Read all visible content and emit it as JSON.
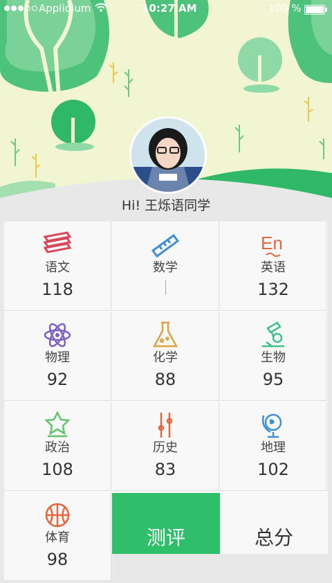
{
  "status_bar": {
    "carrier": "Applidium",
    "time": "10:27 AM",
    "battery": "100 %"
  },
  "profile": {
    "greeting": "Hi! 王烁语同学"
  },
  "subjects": [
    {
      "label": "语文",
      "score": "118",
      "icon": "books-icon"
    },
    {
      "label": "数学",
      "score": "",
      "icon": "ruler-icon"
    },
    {
      "label": "英语",
      "score": "132",
      "icon": "en-icon"
    },
    {
      "label": "物理",
      "score": "92",
      "icon": "atom-icon"
    },
    {
      "label": "化学",
      "score": "88",
      "icon": "flask-icon"
    },
    {
      "label": "生物",
      "score": "95",
      "icon": "microscope-icon"
    },
    {
      "label": "政治",
      "score": "108",
      "icon": "star-badge-icon"
    },
    {
      "label": "历史",
      "score": "83",
      "icon": "scroll-icon"
    },
    {
      "label": "地理",
      "score": "102",
      "icon": "globe-icon"
    },
    {
      "label": "体育",
      "score": "98",
      "icon": "basketball-icon"
    }
  ],
  "actions": {
    "evaluate": "测评",
    "total": "总分"
  },
  "colors": {
    "accent_green": "#2fbf6a",
    "red": "#d8485a",
    "blue": "#3f8fd6",
    "orange": "#e2673c",
    "purple": "#7d5fc8",
    "gold": "#d9a441",
    "teal": "#3fbf8a",
    "lightgreen": "#5fc46a"
  }
}
